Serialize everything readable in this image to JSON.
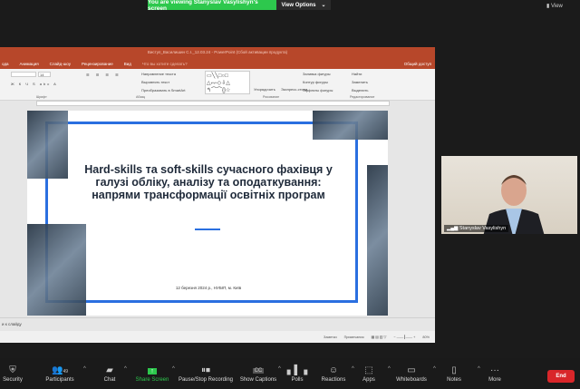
{
  "zoom": {
    "banner": "You are viewing Stanyslav Vasylishyn's screen",
    "view_options": "View Options",
    "view": "View",
    "end": "End",
    "toolbar": [
      {
        "label": "Security",
        "icon": "shield-icon"
      },
      {
        "label": "Participants",
        "icon": "participants-icon",
        "count": "49"
      },
      {
        "label": "Chat",
        "icon": "chat-icon"
      },
      {
        "label": "Share Screen",
        "icon": "share-screen-icon"
      },
      {
        "label": "Pause/Stop Recording",
        "icon": "pause-stop-icon"
      },
      {
        "label": "Show Captions",
        "icon": "cc-icon"
      },
      {
        "label": "Polls",
        "icon": "polls-icon"
      },
      {
        "label": "Reactions",
        "icon": "reactions-icon"
      },
      {
        "label": "Apps",
        "icon": "apps-icon"
      },
      {
        "label": "Whiteboards",
        "icon": "whiteboard-icon"
      },
      {
        "label": "Notes",
        "icon": "notes-icon"
      },
      {
        "label": "More",
        "icon": "more-icon"
      }
    ],
    "colors": {
      "banner": "#2dc84d",
      "end": "#d9262a",
      "share": "#2dc84d"
    },
    "video": {
      "name": "Stanyslav Vasylishyn"
    }
  },
  "ppt": {
    "title": "Виступ_Василишин С.І._12.03.24 - PowerPoint (Сбой активации продукта)",
    "tabs": [
      "ода",
      "Анимация",
      "Слайд-шоу",
      "Рецензирование",
      "Вид",
      "Что вы хотите сделать?"
    ],
    "share": "Общий доступ",
    "ribbon": {
      "font_size": "14",
      "groups": [
        "Шрифт",
        "Абзац",
        "Рисование",
        "Редактирование"
      ],
      "items": {
        "text_dir": "Направление текста",
        "align_text": "Выровнять текст",
        "smartart": "Преобразовать в SmartArt",
        "arrange": "Упорядочить",
        "quick_styles": "Экспресс-стили",
        "fill": "Заливка фигуры",
        "outline": "Контур фигуры",
        "effects": "Эффекты фигуры",
        "find": "Найти",
        "replace": "Заменить",
        "select": "Выделить"
      }
    },
    "slide": {
      "title": "Hard-skills та soft-skills сучасного фахівця у галузі обліку, аналізу та оподаткування: напрями трансформації освітніх програм",
      "date": "12 березня 2024 р., НУБІП, м. Київ"
    },
    "notes": "и к слайду",
    "status": {
      "notes": "Заметки",
      "comments": "Примечания",
      "zoom": "80%"
    },
    "colors": {
      "accent": "#b7472a",
      "slide_blue": "#2a6fe0"
    }
  }
}
